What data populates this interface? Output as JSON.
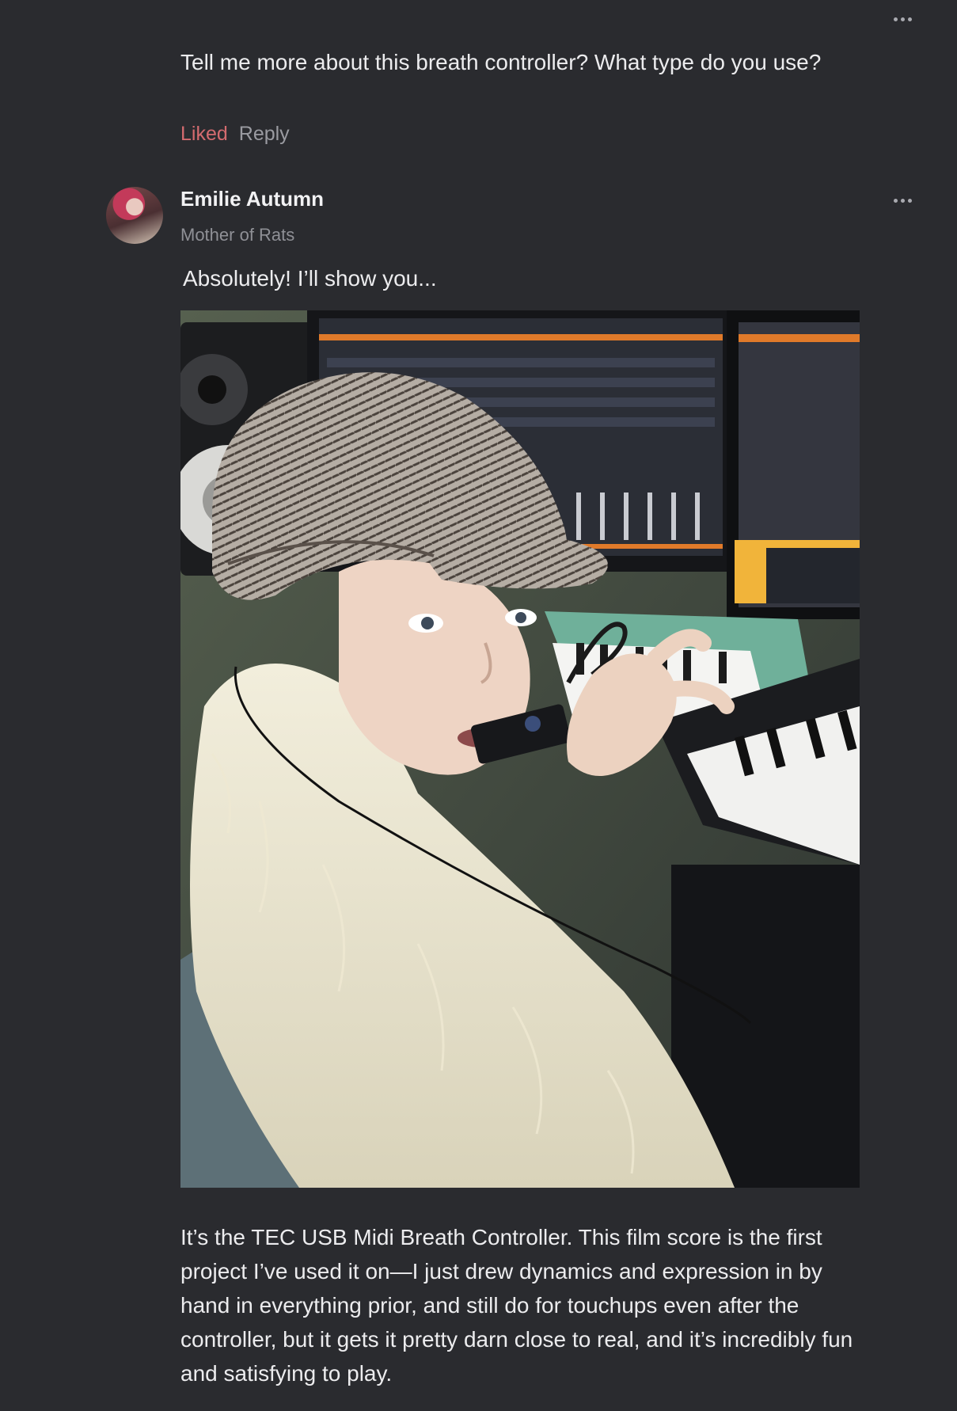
{
  "comments": [
    {
      "text": "Tell me more about this breath controller? What type do you use?",
      "actions": {
        "liked_label": "Liked",
        "reply_label": "Reply"
      }
    },
    {
      "author": "Emilie Autumn",
      "author_title": "Mother of Rats",
      "text": "Absolutely! I’ll show you...",
      "follow_text": "It’s the TEC USB Midi Breath Controller. This film score is the first project I’ve used it on—I just drew dynamics and expression in by hand in everything prior, and still do for touchups even after the controller, but it gets it pretty darn close to real, and it’s incredibly fun and satisfying to play."
    }
  ],
  "colors": {
    "background": "#2a2b2f",
    "liked": "#d46b6f",
    "muted": "#9a9ba1",
    "text": "#ececee"
  },
  "icons": {
    "more": "more-horizontal-icon"
  }
}
